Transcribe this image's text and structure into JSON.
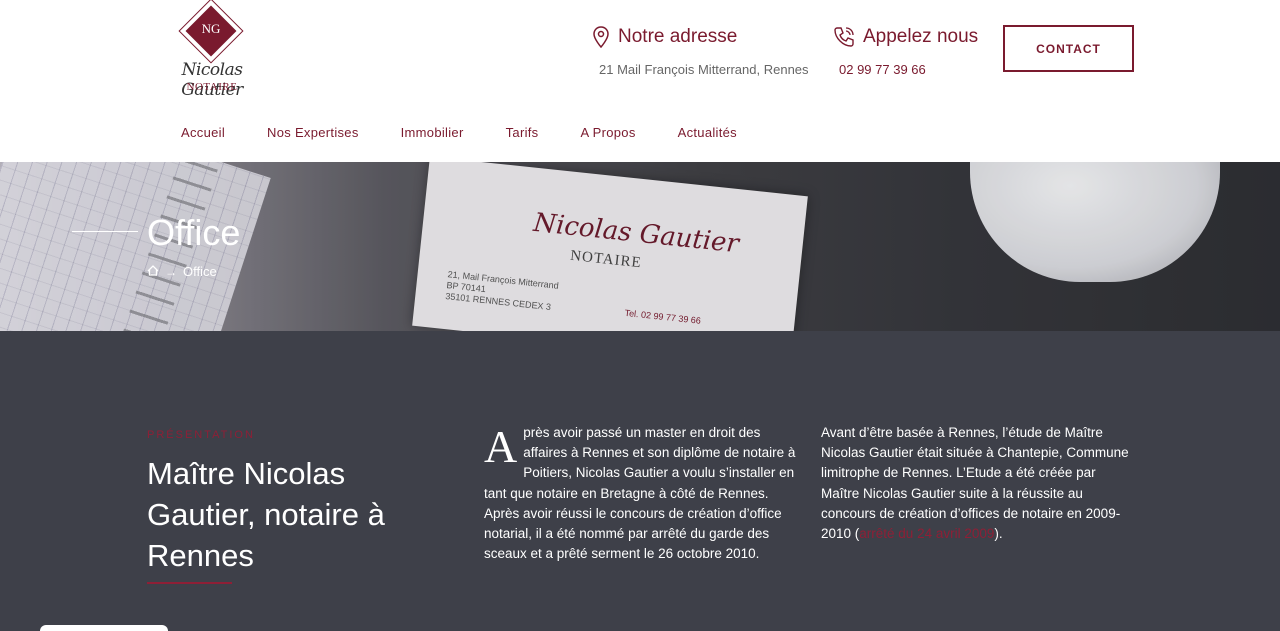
{
  "logo": {
    "monogram": "NG",
    "script": "Nicolas Gautier",
    "subtitle": "NOTAIRE"
  },
  "header": {
    "address": {
      "title": "Notre adresse",
      "value": "21 Mail François Mitterrand, Rennes",
      "icon": "map-pin-icon"
    },
    "phone": {
      "title": "Appelez nous",
      "value": "02 99 77 39 66",
      "icon": "phone-icon"
    },
    "contact_label": "CONTACT"
  },
  "nav": [
    "Accueil",
    "Nos Expertises",
    "Immobilier",
    "Tarifs",
    "A Propos",
    "Actualités"
  ],
  "hero": {
    "title": "Office",
    "breadcrumb_current": "Office",
    "card": {
      "script": "Nicolas Gautier",
      "subtitle": "NOTAIRE",
      "address_line1": "21, Mail François Mitterrand",
      "address_line2": "BP 70141",
      "address_line3": "35101 RENNES CEDEX 3",
      "tel": "Tel. 02 99 77 39 66"
    }
  },
  "presentation": {
    "eyebrow": "PRÉSENTATION",
    "heading": "Maître Nicolas Gautier, notaire à Rennes",
    "col1_dropcap": "A",
    "col1_text": "près avoir passé un master en droit des affaires à Rennes et son diplôme de notaire à Poitiers, Nicolas Gautier a voulu s’installer en tant que notaire en Bretagne à côté de Rennes. Après avoir réussi le concours de création d’office notarial, il a été nommé par arrêté du garde des sceaux et a prêté serment le 26 octobre 2010.",
    "col2_text": "Avant d’être basée à Rennes, l’étude de Maître Nicolas Gautier était située à Chantepie, Commune limitrophe de Rennes. L’Etude a été créée par Maître Nicolas Gautier suite à la réussite au concours de création d’offices de notaire en 2009-2010 (",
    "col2_link": "arrêté du 24 avril 2009",
    "col2_end": ")."
  },
  "colors": {
    "brand": "#7a1a2e",
    "accent": "#8e1f36",
    "dark_bg": "#3e4049"
  }
}
